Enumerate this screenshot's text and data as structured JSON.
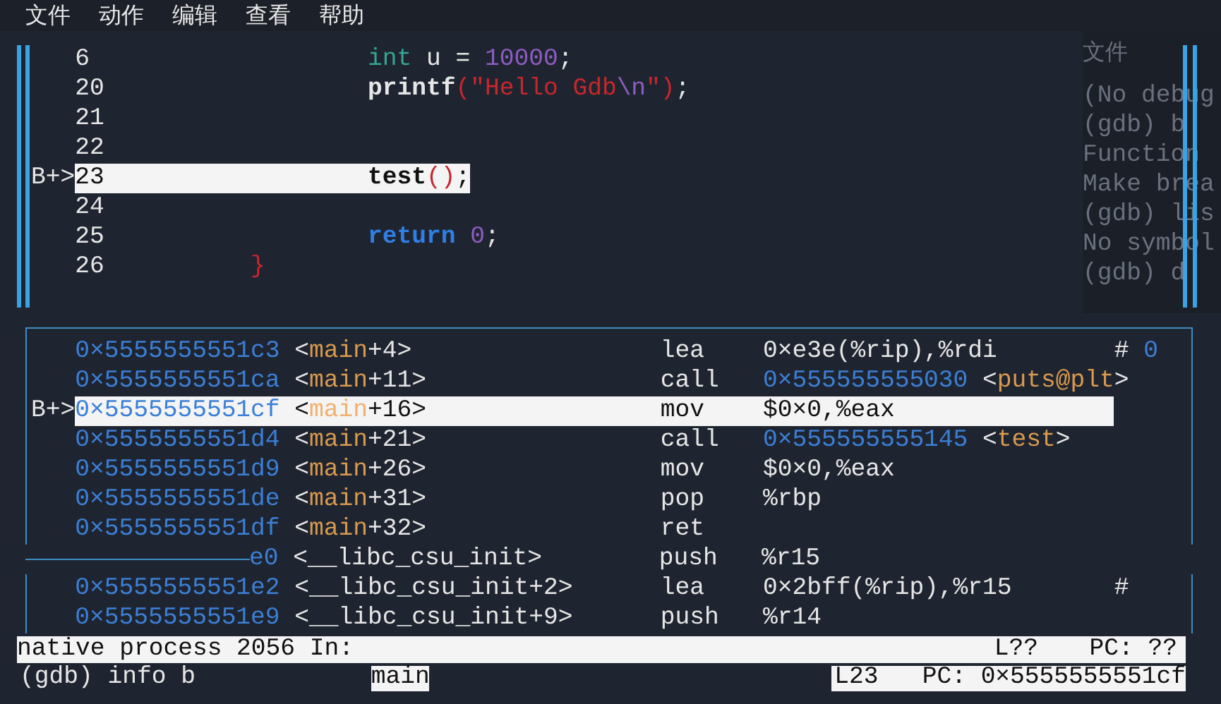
{
  "menu": [
    "文件",
    "动作",
    "编辑",
    "查看",
    "帮助"
  ],
  "background_window": {
    "menu": [
      "文件"
    ],
    "lines": [
      "(No debug",
      "(gdb) b",
      "Function",
      "Make brea",
      "(gdb) lis",
      "No symbol",
      "(gdb) d"
    ]
  },
  "source": {
    "lines": [
      {
        "number": "6",
        "current": false,
        "kind": "body",
        "tokens": [
          {
            "kind": "type",
            "text": "int"
          },
          {
            "kind": "plain",
            "text": " u = "
          },
          {
            "kind": "number",
            "text": "10000"
          },
          {
            "kind": "plain",
            "text": ";"
          }
        ]
      },
      {
        "number": "20",
        "current": false,
        "kind": "body",
        "tokens": [
          {
            "kind": "func",
            "text": "printf"
          },
          {
            "kind": "string",
            "text": "(\"Hello Gdb"
          },
          {
            "kind": "escape",
            "text": "\\n"
          },
          {
            "kind": "string",
            "text": "\")"
          },
          {
            "kind": "plain",
            "text": ";"
          }
        ]
      },
      {
        "number": "21",
        "current": false
      },
      {
        "number": "22",
        "current": false
      },
      {
        "marker": "B+>",
        "number": "23",
        "current": true,
        "kind": "body",
        "tokens": [
          {
            "kind": "func",
            "text": "test"
          },
          {
            "kind": "string",
            "text": "()"
          },
          {
            "kind": "plain",
            "text": ";"
          }
        ]
      },
      {
        "number": "24",
        "current": false
      },
      {
        "number": "25",
        "current": false,
        "kind": "body",
        "tokens": [
          {
            "kind": "keyword",
            "text": "return"
          },
          {
            "kind": "number",
            "text": "0"
          },
          {
            "kind": "plain",
            "text": ";"
          }
        ]
      },
      {
        "number": "26",
        "current": false,
        "kind": "closing",
        "tokens": [
          {
            "kind": "string",
            "text": "}"
          }
        ]
      }
    ]
  },
  "disassembly": {
    "rows": [
      {
        "address": "0×5555555551c3",
        "symbol": [
          {
            "kind": "plain",
            "text": "<"
          },
          {
            "kind": "symbol",
            "text": "main"
          },
          {
            "kind": "plain",
            "text": "+4>"
          }
        ],
        "mnemonic": "lea",
        "operands": [
          {
            "kind": "plain",
            "text": "0×e3e(%rip),%rdi"
          }
        ],
        "comment": [
          {
            "kind": "plain",
            "text": "# "
          },
          {
            "kind": "address",
            "text": "0"
          }
        ],
        "current": false
      },
      {
        "address": "0×5555555551ca",
        "symbol": [
          {
            "kind": "plain",
            "text": "<"
          },
          {
            "kind": "symbol",
            "text": "main"
          },
          {
            "kind": "plain",
            "text": "+11>"
          }
        ],
        "mnemonic": "call",
        "operands": [
          {
            "kind": "address",
            "text": "0×555555555030"
          },
          {
            "kind": "plain",
            "text": " <"
          },
          {
            "kind": "symbol",
            "text": "puts@plt"
          },
          {
            "kind": "plain",
            "text": ">"
          }
        ],
        "current": false
      },
      {
        "marker": "B+>",
        "address": "0×5555555551cf",
        "symbol": [
          {
            "kind": "plain",
            "text": "<"
          },
          {
            "kind": "symbol",
            "text": "main"
          },
          {
            "kind": "plain",
            "text": "+16>"
          }
        ],
        "mnemonic": "mov",
        "operands": [
          {
            "kind": "plain",
            "text": "$0×0,%eax"
          }
        ],
        "current": true
      },
      {
        "address": "0×5555555551d4",
        "symbol": [
          {
            "kind": "plain",
            "text": "<"
          },
          {
            "kind": "symbol",
            "text": "main"
          },
          {
            "kind": "plain",
            "text": "+21>"
          }
        ],
        "mnemonic": "call",
        "operands": [
          {
            "kind": "address",
            "text": "0×555555555145"
          },
          {
            "kind": "plain",
            "text": " <"
          },
          {
            "kind": "symbol",
            "text": "test"
          },
          {
            "kind": "plain",
            "text": ">"
          }
        ],
        "current": false
      },
      {
        "address": "0×5555555551d9",
        "symbol": [
          {
            "kind": "plain",
            "text": "<"
          },
          {
            "kind": "symbol",
            "text": "main"
          },
          {
            "kind": "plain",
            "text": "+26>"
          }
        ],
        "mnemonic": "mov",
        "operands": [
          {
            "kind": "plain",
            "text": "$0×0,%eax"
          }
        ],
        "current": false
      },
      {
        "address": "0×5555555551de",
        "symbol": [
          {
            "kind": "plain",
            "text": "<"
          },
          {
            "kind": "symbol",
            "text": "main"
          },
          {
            "kind": "plain",
            "text": "+31>"
          }
        ],
        "mnemonic": "pop",
        "operands": [
          {
            "kind": "plain",
            "text": "%rbp"
          }
        ],
        "current": false
      },
      {
        "address": "0×5555555551df",
        "symbol": [
          {
            "kind": "plain",
            "text": "<"
          },
          {
            "kind": "symbol",
            "text": "main"
          },
          {
            "kind": "plain",
            "text": "+32>"
          }
        ],
        "mnemonic": "ret",
        "current": false
      },
      {
        "kind": "partial",
        "address": "e0",
        "symbol": [
          {
            "kind": "plain",
            "text": "<__libc_csu_init>"
          }
        ],
        "mnemonic": "push",
        "operands": [
          {
            "kind": "plain",
            "text": "%r15"
          }
        ],
        "current": false
      },
      {
        "address": "0×5555555551e2",
        "symbol": [
          {
            "kind": "plain",
            "text": "<__libc_csu_init+2>"
          }
        ],
        "mnemonic": "lea",
        "operands": [
          {
            "kind": "plain",
            "text": "0×2bff(%rip),%r15"
          }
        ],
        "comment": [
          {
            "kind": "plain",
            "text": "#"
          }
        ],
        "current": false
      },
      {
        "address": "0×5555555551e9",
        "symbol": [
          {
            "kind": "plain",
            "text": "<__libc_csu_init+9>"
          }
        ],
        "mnemonic": "push",
        "operands": [
          {
            "kind": "plain",
            "text": "%r14"
          }
        ],
        "current": false
      }
    ]
  },
  "status_bar": {
    "process": "native process 2056 In:",
    "line": "L??",
    "pc": "PC: ??"
  },
  "command_line": {
    "command": "(gdb) info b",
    "function": "main",
    "location": "L23   PC: 0×5555555551cf"
  }
}
